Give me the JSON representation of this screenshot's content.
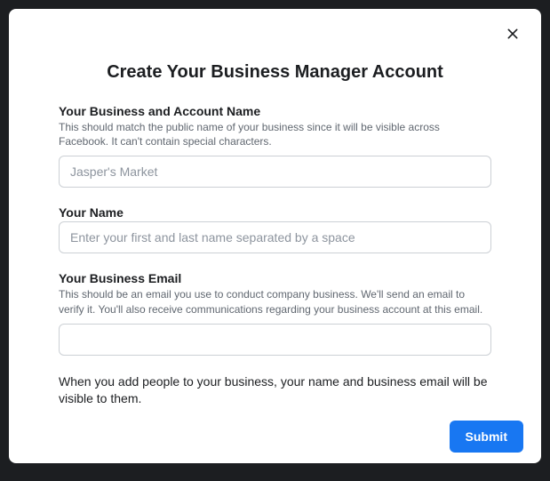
{
  "modal": {
    "title": "Create Your Business Manager Account",
    "fields": {
      "business_name": {
        "label": "Your Business and Account Name",
        "description": "This should match the public name of your business since it will be visible across Facebook. It can't contain special characters.",
        "placeholder": "Jasper's Market"
      },
      "your_name": {
        "label": "Your Name",
        "placeholder": "Enter your first and last name separated by a space"
      },
      "business_email": {
        "label": "Your Business Email",
        "description": "This should be an email you use to conduct company business. We'll send an email to verify it. You'll also receive communications regarding your business account at this email."
      }
    },
    "notice": "When you add people to your business, your name and business email will be visible to them.",
    "submit_label": "Submit"
  }
}
